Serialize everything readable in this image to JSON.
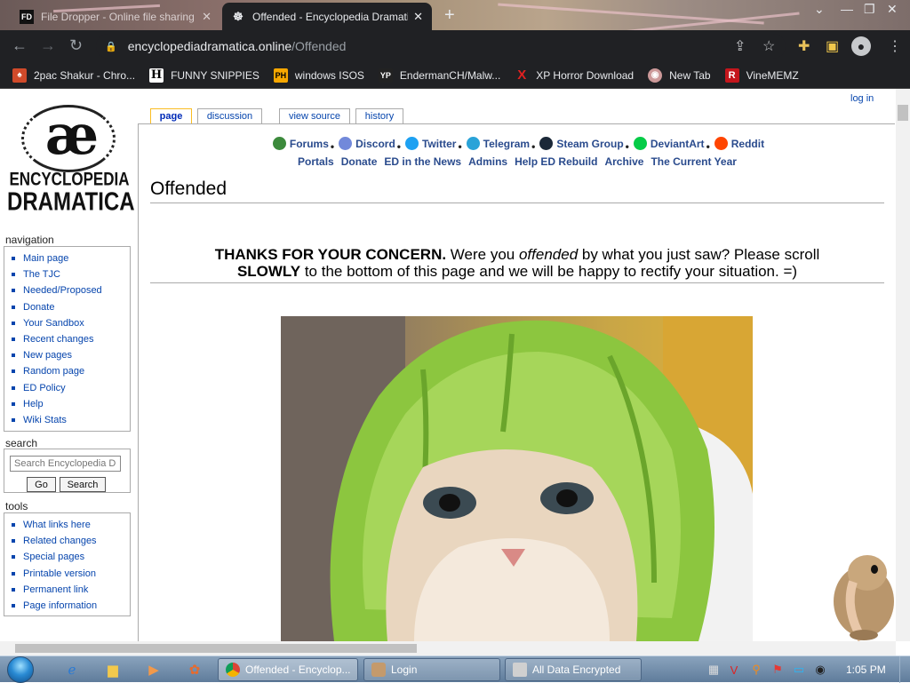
{
  "browser": {
    "tabs": [
      {
        "title": "File Dropper - Online file sharing",
        "favicon": "FD",
        "active": false
      },
      {
        "title": "Offended - Encyclopedia Dramatica",
        "favicon": "ED",
        "active": true
      }
    ],
    "url_host": "encyclopediadramatica.online",
    "url_path": "/Offended",
    "bookmarks": [
      {
        "label": "2pac Shakur - Chro...",
        "icon": "chrome-icon"
      },
      {
        "label": "FUNNY SNIPPIES",
        "icon": "H"
      },
      {
        "label": "windows ISOS",
        "icon": "PH"
      },
      {
        "label": "EndermanCH/Malw...",
        "icon": "YP"
      },
      {
        "label": "XP Horror Download",
        "icon": "X"
      },
      {
        "label": "New Tab",
        "icon": "globe-icon"
      },
      {
        "label": "VineMEMZ",
        "icon": "R"
      }
    ]
  },
  "wiki": {
    "logo": {
      "word1": "ENCYCLOPEDIA",
      "word2": "DRAMATICA",
      "mark": "æ"
    },
    "login": "log in",
    "tabs": [
      "page",
      "discussion",
      "view source",
      "history"
    ],
    "navigation_heading": "navigation",
    "navigation": [
      "Main page",
      "The TJC",
      "Needed/Proposed",
      "Donate",
      "Your Sandbox",
      "Recent changes",
      "New pages",
      "Random page",
      "ED Policy",
      "Help",
      "Wiki Stats"
    ],
    "search_heading": "search",
    "search_placeholder": "Search Encyclopedia Dramatica",
    "go_label": "Go",
    "search_label": "Search",
    "tools_heading": "tools",
    "tools": [
      "What links here",
      "Related changes",
      "Special pages",
      "Printable version",
      "Permanent link",
      "Page information"
    ],
    "sitenav1": [
      {
        "label": "Forums",
        "color": "#3c8a3c"
      },
      {
        "label": "Discord",
        "color": "#7289da"
      },
      {
        "label": "Twitter",
        "color": "#1da1f2"
      },
      {
        "label": "Telegram",
        "color": "#2aa3d8"
      },
      {
        "label": "Steam Group",
        "color": "#1b2838"
      },
      {
        "label": "DeviantArt",
        "color": "#05cc47"
      },
      {
        "label": "Reddit",
        "color": "#ff4500"
      }
    ],
    "sitenav2": [
      "Portals",
      "Donate",
      "ED in the News",
      "Admins",
      "Help ED Rebuild",
      "Archive",
      "The Current Year"
    ],
    "page_title": "Offended",
    "notice": {
      "b1": "THANKS FOR YOUR CONCERN.",
      "t1": " Were you ",
      "i1": "offended",
      "t2": " by what you just saw? Please scroll",
      "b2": "SLOWLY",
      "t3": " to the bottom of this page and we will be happy to rectify your situation. =)"
    }
  },
  "taskbar": {
    "tasks": [
      {
        "label": "Offended - Encyclop...",
        "active": true
      },
      {
        "label": "Login",
        "active": false
      },
      {
        "label": "All Data Encrypted",
        "active": false
      }
    ],
    "clock": "1:05 PM"
  }
}
